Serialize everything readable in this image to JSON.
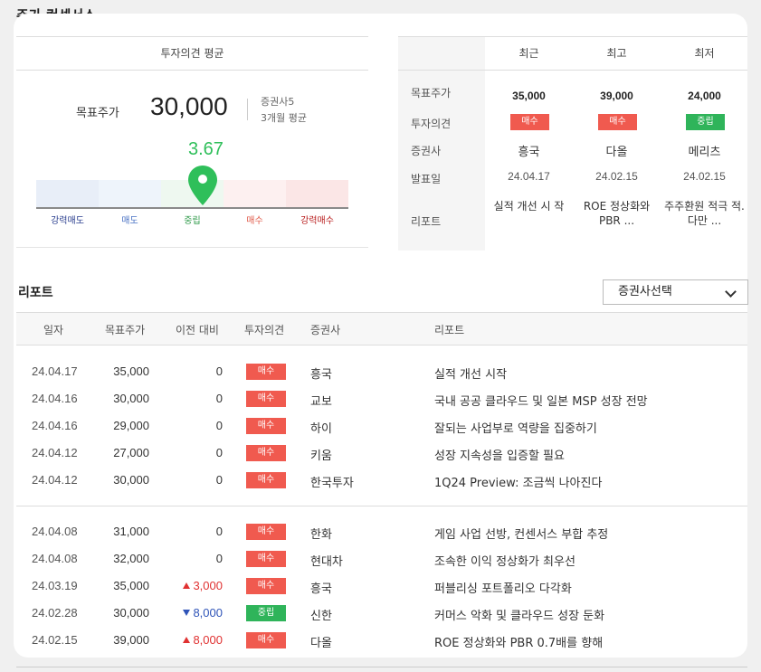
{
  "page_title": "주가 컨센서스",
  "colors": {
    "buy": "#f05a4f",
    "neutral": "#2fb45a",
    "score": "#2fbf5a"
  },
  "consensus": {
    "header": "투자의견 평균",
    "target_label": "목표주가",
    "target_value": "30,000",
    "firms_count": "증권사5",
    "period": "3개월 평균",
    "score": "3.67",
    "scale": [
      "강력매도",
      "매도",
      "중립",
      "매수",
      "강력매수"
    ]
  },
  "recent": {
    "row_labels": [
      "목표주가",
      "투자의견",
      "증권사",
      "발표일",
      "리포트"
    ],
    "columns": [
      {
        "header": "최근",
        "price": "35,000",
        "opinion": "매수",
        "firm": "흥국",
        "date": "24.04.17",
        "report": "실적 개선 시 작"
      },
      {
        "header": "최고",
        "price": "39,000",
        "opinion": "매수",
        "firm": "다올",
        "date": "24.02.15",
        "report": "ROE 정상화와 PBR ..."
      },
      {
        "header": "최저",
        "price": "24,000",
        "opinion": "중립",
        "firm": "메리츠",
        "date": "24.02.15",
        "report": "주주환원 적극 적. 다만 ..."
      }
    ]
  },
  "reports": {
    "title": "리포트",
    "firm_select": "증권사선택",
    "headers": [
      "일자",
      "목표주가",
      "이전 대비",
      "투자의견",
      "증권사",
      "리포트"
    ],
    "rows": [
      {
        "date": "24.04.17",
        "price": "35,000",
        "diff": "0",
        "trend": "",
        "opinion": "매수",
        "firm": "흥국",
        "report": "실적 개선 시작"
      },
      {
        "date": "24.04.16",
        "price": "30,000",
        "diff": "0",
        "trend": "",
        "opinion": "매수",
        "firm": "교보",
        "report": "국내 공공 클라우드 및 일본 MSP 성장 전망"
      },
      {
        "date": "24.04.16",
        "price": "29,000",
        "diff": "0",
        "trend": "",
        "opinion": "매수",
        "firm": "하이",
        "report": "잘되는 사업부로 역량을 집중하기"
      },
      {
        "date": "24.04.12",
        "price": "27,000",
        "diff": "0",
        "trend": "",
        "opinion": "매수",
        "firm": "키움",
        "report": "성장 지속성을 입증할 필요"
      },
      {
        "date": "24.04.12",
        "price": "30,000",
        "diff": "0",
        "trend": "",
        "opinion": "매수",
        "firm": "한국투자",
        "report": "1Q24 Preview: 조금씩 나아진다"
      },
      {
        "date": "24.04.08",
        "price": "31,000",
        "diff": "0",
        "trend": "",
        "opinion": "매수",
        "firm": "한화",
        "report": "게임 사업 선방, 컨센서스 부합 추정"
      },
      {
        "date": "24.04.08",
        "price": "32,000",
        "diff": "0",
        "trend": "",
        "opinion": "매수",
        "firm": "현대차",
        "report": "조속한 이익 정상화가 최우선"
      },
      {
        "date": "24.03.19",
        "price": "35,000",
        "diff": "3,000",
        "trend": "up",
        "opinion": "매수",
        "firm": "흥국",
        "report": "퍼블리싱 포트폴리오 다각화"
      },
      {
        "date": "24.02.28",
        "price": "30,000",
        "diff": "8,000",
        "trend": "down",
        "opinion": "중립",
        "firm": "신한",
        "report": "커머스 악화 및 클라우드 성장 둔화"
      },
      {
        "date": "24.02.15",
        "price": "39,000",
        "diff": "8,000",
        "trend": "up",
        "opinion": "매수",
        "firm": "다올",
        "report": "ROE 정상화와 PBR 0.7배를 향해"
      }
    ]
  }
}
